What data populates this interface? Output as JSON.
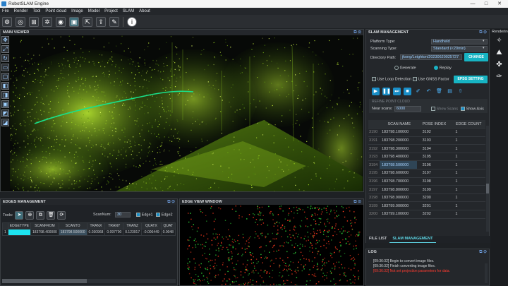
{
  "window": {
    "title": "RobotSLAM Engine",
    "min": "—",
    "max": "□",
    "close": "✕"
  },
  "menu": [
    "File",
    "Render",
    "Tool",
    "Point cloud",
    "Image",
    "Model",
    "Project",
    "SLAM",
    "About"
  ],
  "main_view": {
    "title": "MAIN VIEWER"
  },
  "edges": {
    "title": "EDGES MANAGEMENT",
    "tools_label": "Tools:",
    "scannum_label": "ScanNum:",
    "scannum_value": "30",
    "edge1": "Edge1",
    "edge2": "Edge2",
    "columns": [
      "",
      "EDGETYPE",
      "SCANFROM",
      "SCANTO",
      "TRANX",
      "TRANY",
      "TRANZ",
      "QUATX",
      "QUAT"
    ],
    "row": [
      "1",
      "",
      "183798.400000",
      "183798.500000",
      "0.030968",
      "0.097700",
      "0.123917",
      "-0.006449",
      "0.0048"
    ]
  },
  "edge_view": {
    "title": "EDGE VIEW WINDOW"
  },
  "slam": {
    "title": "SLAM MANAGEMENT",
    "platform_label": "Platform Type:",
    "platform_value": "Handheld",
    "scanning_label": "Scanning Type:",
    "scanning_value": "Standard (<20min)",
    "dir_label": "Directory Path:",
    "dir_value": "jkong/Leighton/20230620025727",
    "change_btn": "CHANGE",
    "generate": "Generate",
    "replay": "Replay",
    "loop": "Use Loop Detection",
    "gnss": "Use GNSS Factor",
    "epsg_btn": "EPSG SETTING",
    "refine_title": "REFINE POINT CLOUD",
    "near_label": "Near scans:",
    "near_value": "6000",
    "show_scans": "Show Scans",
    "show_axis": "Show Axis",
    "columns": [
      "SCAN NAME",
      "POSE INDEX",
      "EDGE COUNT"
    ],
    "rows": [
      [
        "3190",
        "183798.100000",
        "3192",
        "1"
      ],
      [
        "3191",
        "183798.200000",
        "3193",
        "1"
      ],
      [
        "3192",
        "183798.300000",
        "3194",
        "1"
      ],
      [
        "3193",
        "183798.400000",
        "3195",
        "1"
      ],
      [
        "3194",
        "183798.500000",
        "3196",
        "1"
      ],
      [
        "3195",
        "183798.600000",
        "3197",
        "1"
      ],
      [
        "3196",
        "183798.700000",
        "3198",
        "1"
      ],
      [
        "3197",
        "183798.800000",
        "3199",
        "1"
      ],
      [
        "3198",
        "183798.900000",
        "3200",
        "1"
      ],
      [
        "3199",
        "183799.000000",
        "3201",
        "1"
      ],
      [
        "3200",
        "183799.100000",
        "3202",
        "1"
      ]
    ],
    "tab_file": "FILE LIST",
    "tab_slam": "SLAM MANAGEMENT"
  },
  "log": {
    "title": "LOG",
    "lines": [
      {
        "text": "[09:36:32] Begin to convert image files.",
        "color": "#d0d3d6"
      },
      {
        "text": "[09:36:32] Finish converting image files.",
        "color": "#d0d3d6"
      },
      {
        "text": "[09:36:32] Not set projection parameters for data.",
        "color": "#ff3b30"
      }
    ]
  },
  "right_dock": {
    "title": "Rendering"
  },
  "colors": {
    "accent": "#17b4c3",
    "points": "#9bd21e",
    "trajectory": "#19e08a"
  }
}
